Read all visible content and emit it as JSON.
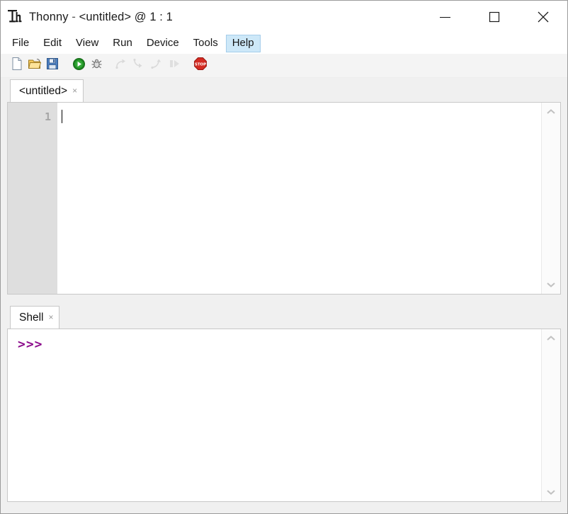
{
  "window": {
    "title_app": "Thonny",
    "title_dash": "-",
    "title_file": "<untitled>",
    "title_position": "@  1 : 1",
    "logo_icon": "thonny-th-logo-icon",
    "controls": [
      {
        "name": "minimize",
        "label": "minimize-icon"
      },
      {
        "name": "maximize",
        "label": "maximize-icon"
      },
      {
        "name": "close",
        "label": "close-icon"
      }
    ]
  },
  "menubar": {
    "items": [
      {
        "label": "File",
        "active": false
      },
      {
        "label": "Edit",
        "active": false
      },
      {
        "label": "View",
        "active": false
      },
      {
        "label": "Run",
        "active": false
      },
      {
        "label": "Device",
        "active": false
      },
      {
        "label": "Tools",
        "active": false
      },
      {
        "label": "Help",
        "active": true
      }
    ],
    "active_highlight_color": "#cde8f8"
  },
  "toolbar": {
    "buttons": [
      {
        "name": "new-file",
        "icon": "new-file-icon",
        "enabled": true
      },
      {
        "name": "open-file",
        "icon": "open-folder-icon",
        "enabled": true
      },
      {
        "name": "save-file",
        "icon": "save-floppy-icon",
        "enabled": true
      },
      {
        "name": "run",
        "icon": "run-play-icon",
        "enabled": true
      },
      {
        "name": "debug",
        "icon": "debug-bug-icon",
        "enabled": true
      },
      {
        "name": "step-over",
        "icon": "step-over-icon",
        "enabled": false
      },
      {
        "name": "step-into",
        "icon": "step-into-icon",
        "enabled": false
      },
      {
        "name": "step-out",
        "icon": "step-out-icon",
        "enabled": false
      },
      {
        "name": "resume",
        "icon": "resume-icon",
        "enabled": false
      },
      {
        "name": "stop",
        "icon": "stop-sign-icon",
        "enabled": true
      }
    ]
  },
  "editor": {
    "tab_label": "<untitled>",
    "tab_close": "×",
    "line_numbers": [
      "1"
    ],
    "code_lines": [
      ""
    ],
    "cursor_line": 1,
    "cursor_column": 1
  },
  "shell": {
    "tab_label": "Shell",
    "tab_close": "×",
    "prompt": ">>>",
    "prompt_color": "#8b0a8b",
    "output_lines": []
  },
  "scrollbars": {
    "up_arrow": "chevron-up-icon",
    "down_arrow": "chevron-down-icon"
  }
}
